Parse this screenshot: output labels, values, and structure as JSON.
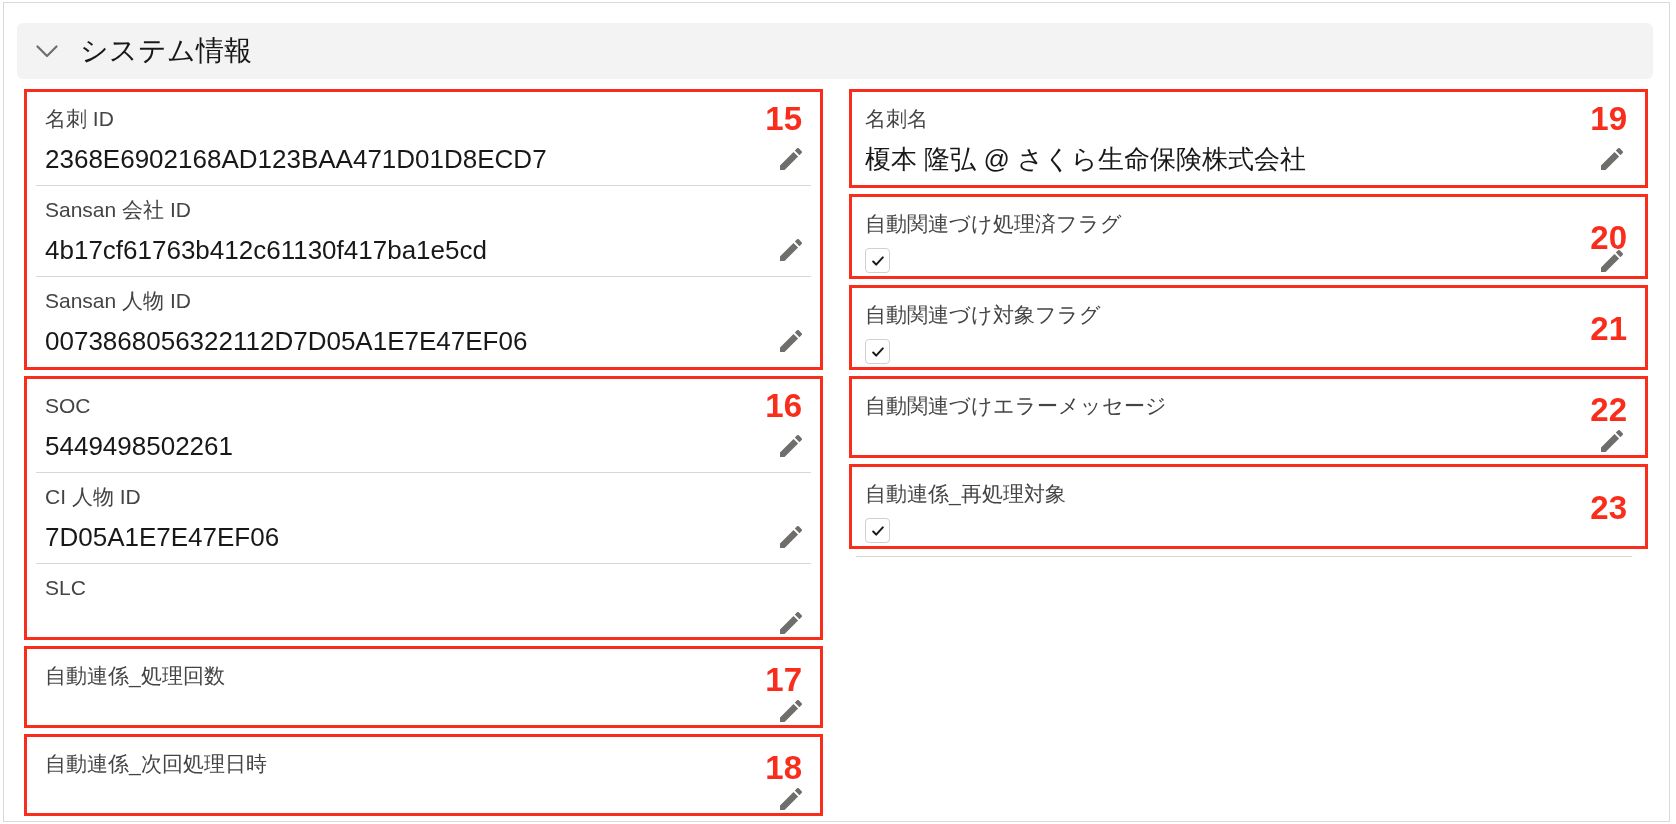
{
  "section": {
    "title": "システム情報",
    "expanded": true
  },
  "columns": [
    {
      "groups": [
        {
          "marker": "15",
          "fields": [
            {
              "kind": "text",
              "label": "名刺 ID",
              "value": "2368E6902168AD123BAA471D01D8ECD7",
              "editable": true
            },
            {
              "kind": "text",
              "label": "Sansan 会社 ID",
              "value": "4b17cf61763b412c61130f417ba1e5cd",
              "editable": true
            },
            {
              "kind": "text",
              "label": "Sansan 人物 ID",
              "value": "0073868056322112D7D05A1E7E47EF06",
              "editable": true
            }
          ]
        },
        {
          "marker": "16",
          "fields": [
            {
              "kind": "text",
              "label": "SOC",
              "value": "5449498502261",
              "editable": true
            },
            {
              "kind": "text",
              "label": "CI 人物 ID",
              "value": "7D05A1E7E47EF06",
              "editable": true
            },
            {
              "kind": "text",
              "label": "SLC",
              "editable": true
            }
          ]
        },
        {
          "marker": "17",
          "fields": [
            {
              "kind": "text",
              "label": "自動連係_処理回数",
              "editable": true
            }
          ]
        },
        {
          "marker": "18",
          "fields": [
            {
              "kind": "text",
              "label": "自動連係_次回処理日時",
              "editable": true
            }
          ]
        }
      ]
    },
    {
      "groups": [
        {
          "marker": "19",
          "fields": [
            {
              "kind": "text",
              "label": "名刺名",
              "value": "榎本 隆弘 @ さくら生命保険株式会社",
              "editable": true
            }
          ]
        },
        {
          "marker": "20",
          "fields": [
            {
              "kind": "checkbox",
              "label": "自動関連づけ処理済フラグ",
              "checked": true,
              "editable": true
            }
          ]
        },
        {
          "marker": "21",
          "fields": [
            {
              "kind": "checkbox",
              "label": "自動関連づけ対象フラグ",
              "checked": true,
              "editable": false
            }
          ]
        },
        {
          "marker": "22",
          "fields": [
            {
              "kind": "text",
              "label": "自動関連づけエラーメッセージ",
              "editable": true
            }
          ]
        },
        {
          "marker": "23",
          "fields": [
            {
              "kind": "checkbox",
              "label": "自動連係_再処理対象",
              "checked": true,
              "editable": false
            }
          ]
        }
      ]
    }
  ]
}
